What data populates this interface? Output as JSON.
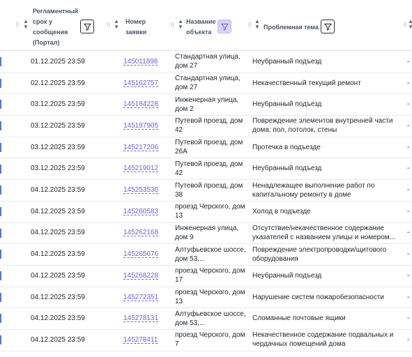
{
  "table": {
    "headers": {
      "deadline": "Регламентный срок у сообщения (Портал)",
      "deadline_lines": [
        "Регламентный",
        "срок у",
        "сообщения",
        "(Портал)"
      ],
      "number_lines": [
        "Номер",
        "заявки"
      ],
      "object_lines": [
        "Название",
        "объекта"
      ],
      "topic": "Проблемная тема"
    },
    "rows": [
      {
        "date": "01.12.2025 23:59",
        "number": "145011898",
        "object": "Стандартная улица, дом 27",
        "topic": "Неубранный подъезд",
        "dash": "-"
      },
      {
        "date": "02.12.2025 23:59",
        "number": "145162757",
        "object": "Стандартная улица, дом 27",
        "topic": "Некачественный текущий ремонт",
        "dash": "-"
      },
      {
        "date": "03.12.2025 23:59",
        "number": "145184228",
        "object": "Инженерная улица, дом 2",
        "topic": "Неубранный подъезд",
        "dash": "-"
      },
      {
        "date": "03.12.2025 23:59",
        "number": "145187905",
        "object": "Путевой проезд, дом 42",
        "topic": "Повреждение элементов внутренней части дома: пол, потолок, стены",
        "dash": "-"
      },
      {
        "date": "03.12.2025 23:59",
        "number": "145217206",
        "object": "Путевой проезд, дом 26А",
        "topic": "Протечка в подъезде",
        "dash": "-"
      },
      {
        "date": "03.12.2025 23:59",
        "number": "145219012",
        "object": "Путевой проезд, дом 42",
        "topic": "Неубранный подъезд",
        "dash": "-"
      },
      {
        "date": "04.12.2025 23:59",
        "number": "145253530",
        "object": "Путевой проезд, дом 38",
        "topic": "Ненадлежащее выполнение работ по капитальному ремонту в доме",
        "dash": "-"
      },
      {
        "date": "04.12.2025 23:59",
        "number": "145260583",
        "object": "проезд Черского, дом 13",
        "topic": "Холод в подъезде",
        "dash": "-"
      },
      {
        "date": "04.12.2025 23:59",
        "number": "145262168",
        "object": "Инженерная улица, дом 9",
        "topic": "Отсутствие/некачественное содержание указателей с названием улицы и номером...",
        "dash": "-"
      },
      {
        "date": "04.12.2025 23:59",
        "number": "145265676",
        "object": "Алтуфьевское шоссе, дом 53,...",
        "topic": "Повреждение электропроводки/щитового оборудования",
        "dash": "-"
      },
      {
        "date": "04.12.2025 23:59",
        "number": "145268228",
        "object": "проезд Черского, дом 17",
        "topic": "Неубранный подъезд",
        "dash": "-"
      },
      {
        "date": "04.12.2025 23:59",
        "number": "145272351",
        "object": "проезд Черского, дом 13",
        "topic": "Нарушение систем пожаробезопасности",
        "dash": "-"
      },
      {
        "date": "04.12.2025 23:59",
        "number": "145278131",
        "object": "Алтуфьевское шоссе, дом 53,...",
        "topic": "Сломанные почтовые ящики",
        "dash": "-"
      },
      {
        "date": "04.12.2025 23:59",
        "number": "145278411",
        "object": "проезд Черского, дом 7",
        "topic": "Некачественное содержание подвальных и чердачных помещений дома",
        "dash": "-"
      }
    ]
  },
  "icons": {
    "drag": "drag-handle-icon",
    "sort": "sort-icon",
    "filter": "filter-icon"
  },
  "colors": {
    "link": "#6f5fd6",
    "active_filter_bg": "#d9d4f5",
    "row_marker": "#4a7bd0"
  }
}
